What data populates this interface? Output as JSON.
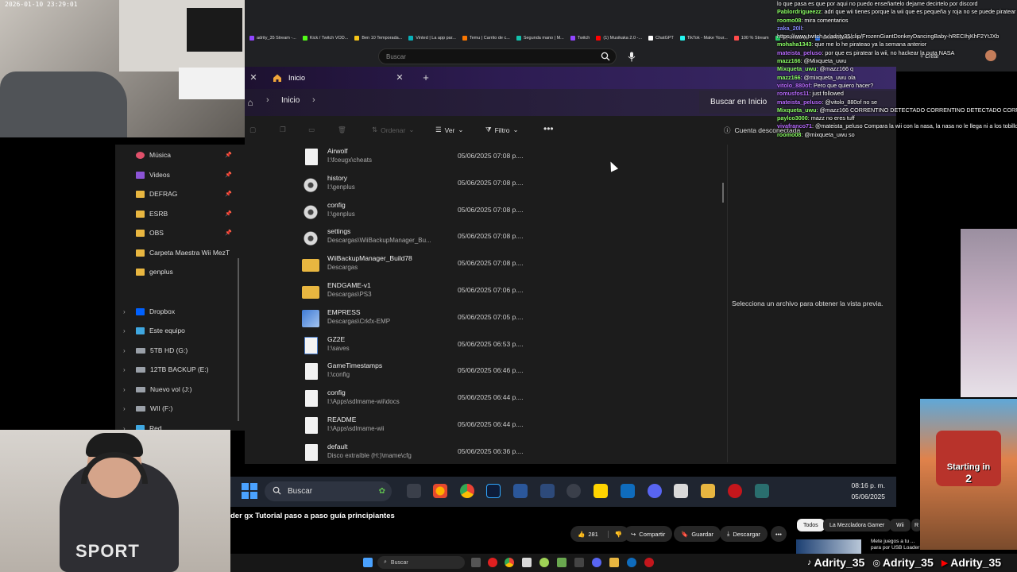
{
  "webcam": {
    "timestamp": "2026-01-10 23:29:01"
  },
  "webcam_bottom": {
    "shirt_text": "SPORT"
  },
  "game": {
    "starting_text": "Starting in",
    "count": "2"
  },
  "browser": {
    "bookmarks": [
      {
        "label": "adrity_35 Stream -...",
        "color": "#9146ff"
      },
      {
        "label": "Kick / Twitch VOD...",
        "color": "#53fc18"
      },
      {
        "label": "Ben 10 Temporada...",
        "color": "#f5c518"
      },
      {
        "label": "Vinted | La app par...",
        "color": "#09b1ba"
      },
      {
        "label": "Temu | Carrito de c...",
        "color": "#fb7701"
      },
      {
        "label": "Segunda mano | M...",
        "color": "#13c1ac"
      },
      {
        "label": "Twitch",
        "color": "#9146ff"
      },
      {
        "label": "(1) Musikaka 2.0 -...",
        "color": "#ff0000"
      },
      {
        "label": "ChatGPT",
        "color": "#ffffff"
      },
      {
        "label": "TikTok - Make Your...",
        "color": "#25f4ee"
      },
      {
        "label": "100 % Stream",
        "color": "#ff4b4b"
      },
      {
        "label": "(3) WhatsApp",
        "color": "#25d366"
      },
      {
        "label": "Send Anywhere - F...",
        "color": "#3b82f6"
      }
    ],
    "yt_search_placeholder": "Buscar",
    "crear_label": "Crear",
    "chat_tab": "Chat"
  },
  "explorer": {
    "tab_label": "Inicio",
    "breadcrumb": "Inicio",
    "search_placeholder": "Buscar en Inicio",
    "commands": {
      "sort": "Ordenar",
      "view": "Ver",
      "filter": "Filtro",
      "account": "Cuenta desconectada",
      "preview": "Vista previa"
    },
    "nav": [
      {
        "label": "Música",
        "type": "music",
        "pinned": true
      },
      {
        "label": "Videos",
        "type": "video",
        "pinned": true
      },
      {
        "label": "DEFRAG",
        "type": "folder",
        "pinned": true
      },
      {
        "label": "ESRB",
        "type": "folder",
        "pinned": true
      },
      {
        "label": "OBS",
        "type": "folder",
        "pinned": true
      },
      {
        "label": "Carpeta Maestra Wii MezT",
        "type": "folder",
        "pinned": false
      },
      {
        "label": "genplus",
        "type": "folder",
        "pinned": false
      },
      {
        "label": "Dropbox",
        "type": "dropbox",
        "expandable": true
      },
      {
        "label": "Este equipo",
        "type": "pc",
        "expandable": true
      },
      {
        "label": "5TB HD (G:)",
        "type": "drive",
        "expandable": true
      },
      {
        "label": "12TB BACKUP (E:)",
        "type": "drive",
        "expandable": true
      },
      {
        "label": "Nuevo vol (J:)",
        "type": "drive",
        "expandable": true
      },
      {
        "label": "WII (F:)",
        "type": "drive",
        "expandable": true
      },
      {
        "label": "Red",
        "type": "network",
        "expandable": true
      }
    ],
    "files": [
      {
        "name": "Airwolf",
        "path": "I:\\fceugx\\cheats",
        "date": "05/06/2025 07:08 p....",
        "icon": "file"
      },
      {
        "name": "history",
        "path": "I:\\genplus",
        "date": "05/06/2025 07:08 p....",
        "icon": "gear"
      },
      {
        "name": "config",
        "path": "I:\\genplus",
        "date": "05/06/2025 07:08 p....",
        "icon": "gear"
      },
      {
        "name": "settings",
        "path": "Descargas\\WiiBackupManager_Bu...",
        "date": "05/06/2025 07:08 p....",
        "icon": "gear"
      },
      {
        "name": "WiiBackupManager_Build78",
        "path": "Descargas",
        "date": "05/06/2025 07:08 p....",
        "icon": "folder"
      },
      {
        "name": "ENDGAME-v1",
        "path": "Descargas\\PS3",
        "date": "05/06/2025 07:06 p....",
        "icon": "folder"
      },
      {
        "name": "EMPRESS",
        "path": "Descargas\\Crkfx-EMP",
        "date": "05/06/2025 07:05 p....",
        "icon": "app"
      },
      {
        "name": "GZ2E",
        "path": "I:\\saves",
        "date": "05/06/2025 06:53 p....",
        "icon": "doc"
      },
      {
        "name": "GameTimestamps",
        "path": "I:\\config",
        "date": "05/06/2025 06:46 p....",
        "icon": "file"
      },
      {
        "name": "config",
        "path": "I:\\Apps\\sdlmame-wii\\docs",
        "date": "05/06/2025 06:44 p....",
        "icon": "file"
      },
      {
        "name": "README",
        "path": "I:\\Apps\\sdlmame-wii",
        "date": "05/06/2025 06:44 p....",
        "icon": "file"
      },
      {
        "name": "default",
        "path": "Disco extraíble (H:)\\mame\\cfg",
        "date": "05/06/2025 06:36 p....",
        "icon": "file"
      }
    ],
    "preview_message": "Selecciona un archivo para obtener la vista previa."
  },
  "taskbar": {
    "search_label": "Buscar",
    "time": "08:16 p. m.",
    "date": "05/06/2025"
  },
  "youtube": {
    "title_fragment": "der gx Tutorial paso a paso guía principiantes",
    "likes": "281",
    "share": "Compartir",
    "save": "Guardar",
    "download": "Descargar",
    "chips": [
      "Todos",
      "La Mezcladora Gamer",
      "Wii",
      "R"
    ],
    "rec_title": "Mete juegos a tu ... para por USB Loader"
  },
  "os": {
    "search_label": "Buscar"
  },
  "socials": [
    "Adrity_35",
    "Adrity_35",
    "Adrity_35"
  ],
  "chat": [
    {
      "user": "",
      "msg": "lo que pasa es que por aqui no puedo enseñartelo dejame decirtelo por discord",
      "color": "#ffffff"
    },
    {
      "user": "Pablordrigueezz",
      "msg": "adri que wii tienes porque la wii que es pequeña y roja no se puede piratear",
      "color": "#8cff66"
    },
    {
      "user": "roomo08",
      "msg": "mira comentarios",
      "color": "#8cff66"
    },
    {
      "user": "zaka_20ll",
      "msg": "",
      "color": "#8a8aff"
    },
    {
      "user": "",
      "msg": "https://www.twitch.tv/adrity35/clip/FrozenGiantDonkeyDancingBaby-hRECIhjKhF2YtJXb",
      "color": "#ffffff"
    },
    {
      "user": "mohaha1343",
      "msg": "que me lo he pirateao ya la semana anterior",
      "color": "#8cff66"
    },
    {
      "user": "mateista_peluso",
      "msg": "por que es piratear la wii, no hackear la puta NASA",
      "color": "#b96bff"
    },
    {
      "user": "mazz166",
      "msg": "@Mixqueta_uwu",
      "color": "#8cff66"
    },
    {
      "user": "Mixqueta_uwu",
      "msg": "@mazz166 q",
      "color": "#8cff66"
    },
    {
      "user": "mazz166",
      "msg": "@mixqueta_uwu ola",
      "color": "#8cff66"
    },
    {
      "user": "vitolo_880of",
      "msg": "Pero que quiero hacer?",
      "color": "#b96bff"
    },
    {
      "user": "romusfos11",
      "msg": "just followed",
      "color": "#b96bff"
    },
    {
      "user": "mateista_peluso",
      "msg": "@vitolo_880of no se",
      "color": "#b96bff"
    },
    {
      "user": "Mixqueta_uwu",
      "msg": "@mazz166 CORRENTINO DETECTADO CORRENTINO DETECTADO CORRENTINO DETECTADO",
      "color": "#8cff66"
    },
    {
      "user": "paylco3000",
      "msg": "mazz no eres tuff",
      "color": "#8cff66"
    },
    {
      "user": "vivafranco71",
      "msg": "@mateista_peluso Compara la wii con la nasa, la nasa no le llega ni a los tobillos a la wii",
      "color": "#b96bff"
    },
    {
      "user": "roomo08",
      "msg": "@mixqueta_uwu so",
      "color": "#8cff66"
    }
  ]
}
